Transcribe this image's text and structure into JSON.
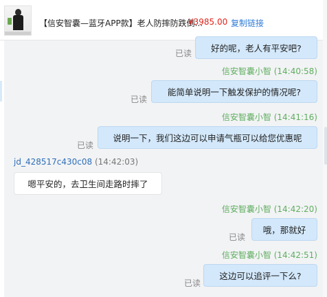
{
  "product": {
    "title": "【信安智囊—蓝牙APP款】老人防摔防跌倒...",
    "price": "¥3985.00",
    "copy_link": "复制链接",
    "thumbnail": "product-thumbnail"
  },
  "messages": [
    {
      "direction": "out",
      "text": "好的呢，老人有平安吧?",
      "status": "已读"
    },
    {
      "direction": "out",
      "sender": "信安智囊小智",
      "time": "(14:40:58)",
      "text": "能简单说明一下触发保护的情况呢?",
      "status": "已读"
    },
    {
      "direction": "out",
      "sender": "信安智囊小智",
      "time": "(14:41:16)",
      "text": "说明一下，我们这边可以申请气瓶可以给您优惠呢",
      "status": "已读"
    },
    {
      "direction": "in",
      "sender": "jd_428517c430c08",
      "time": "(14:42:03)",
      "text": "嗯平安的，去卫生间走路时摔了"
    },
    {
      "direction": "out",
      "sender": "信安智囊小智",
      "time": "(14:42:20)",
      "text": "哦，那就好",
      "status": "已读"
    },
    {
      "direction": "out",
      "sender": "信安智囊小智",
      "time": "(14:42:51)",
      "text": "这边可以追评一下么?",
      "status": "已读"
    }
  ],
  "colors": {
    "agent_name": "#5fae5f",
    "customer_name": "#2f6fb8",
    "price": "#e2231a",
    "link": "#2f7bd6",
    "outgoing_bubble": "#d3e8fb"
  }
}
